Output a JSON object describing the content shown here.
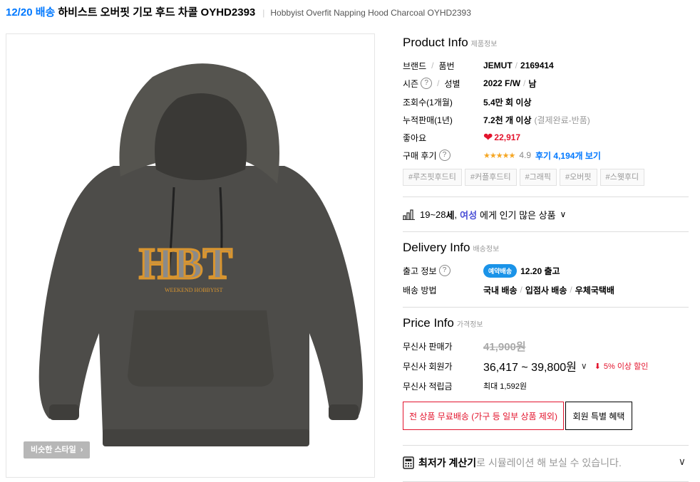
{
  "header": {
    "ship_date": "12/20 배송",
    "title_ko": "하비스트 오버핏 기모 후드 차콜 OYHD2393",
    "separator": "|",
    "title_en": "Hobbyist Overfit Napping Hood Charcoal OYHD2393"
  },
  "image": {
    "similar_style_label": "비슷한 스타일",
    "hoodie_print": "HBT",
    "hoodie_script": "WEEKEND HOBBYIST",
    "colors": {
      "hoodie": "#4d4c49",
      "print_orange": "#d9952f",
      "print_grey": "#8a8a8a"
    }
  },
  "product_info": {
    "title": "Product Info",
    "subtitle": "제품정보",
    "brand_label": "브랜드",
    "code_label": "품번",
    "brand": "JEMUT",
    "code": "2169414",
    "season_label": "시즌",
    "gender_label": "성별",
    "season": "2022 F/W",
    "gender": "남",
    "views_label": "조회수(1개월)",
    "views": "5.4만 회 이상",
    "sales_label": "누적판매(1년)",
    "sales": "7.2천 개 이상",
    "sales_note": "(결제완료-반품)",
    "likes_label": "좋아요",
    "likes": "22,917",
    "review_label": "구매 후기",
    "stars": "★★★★★",
    "rating": "4.9",
    "review_link": "후기 4,194개 보기",
    "tags": [
      "#루즈핏후드티",
      "#커플후드티",
      "#그래픽",
      "#오버핏",
      "#스웻후디"
    ]
  },
  "ranking": {
    "age": "19~28",
    "age_suffix": "세",
    "comma": ",",
    "gender": "여성",
    "text": "에게 인기 많은 상품"
  },
  "delivery_info": {
    "title": "Delivery Info",
    "subtitle": "배송정보",
    "release_label": "출고 정보",
    "badge": "예약배송",
    "release": "12.20 출고",
    "method_label": "배송 방법",
    "method_1": "국내 배송",
    "method_2": "입점사 배송",
    "method_3": "우체국택배"
  },
  "price_info": {
    "title": "Price Info",
    "subtitle": "가격정보",
    "sale_label": "무신사 판매가",
    "sale_price": "41,900원",
    "member_label": "무신사 회원가",
    "member_price": "36,417 ~ 39,800원",
    "discount": "5% 이상 할인",
    "points_label": "무신사 적립금",
    "points": "최대 1,592원"
  },
  "buttons": {
    "free_shipping": "전 상품 무료배송 (가구 등 일부 상품 제외)",
    "member_benefit": "회원 특별 혜택"
  },
  "calculator": {
    "bold": "최저가 계산기",
    "rest": "로 시뮬레이션 해 보실 수 있습니다."
  }
}
